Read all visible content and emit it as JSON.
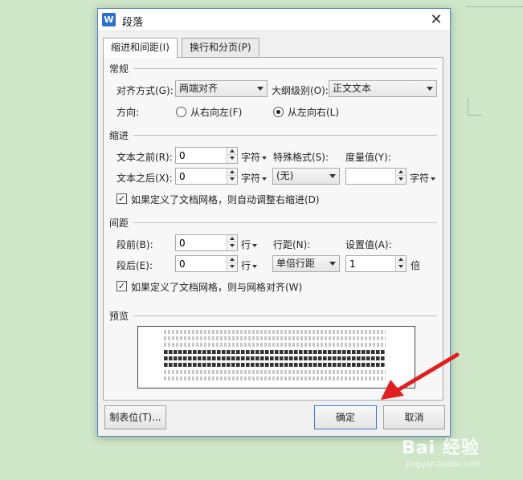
{
  "dialog": {
    "title": "段落",
    "app_icon": "W",
    "close_glyph": "✕"
  },
  "tabs": [
    {
      "label": "缩进和间距(I)",
      "active": true
    },
    {
      "label": "换行和分页(P)",
      "active": false
    }
  ],
  "general": {
    "section_title": "常规",
    "alignment_label": "对齐方式(G):",
    "alignment_value": "两端对齐",
    "outline_label": "大纲级别(O):",
    "outline_value": "正文文本",
    "direction_label": "方向:",
    "rtl_label": "从右向左(F)",
    "ltr_label": "从左向右(L)",
    "ltr_selected": true
  },
  "indent": {
    "section_title": "缩进",
    "before_label": "文本之前(R):",
    "before_value": "0",
    "after_label": "文本之后(X):",
    "after_value": "0",
    "unit": "字符",
    "special_label": "特殊格式(S):",
    "special_value": "(无)",
    "measure_label": "度量值(Y):",
    "measure_value": "",
    "measure_unit": "字符",
    "grid_checkbox_label": "如果定义了文档网格，则自动调整右缩进(D)",
    "grid_checked": true,
    "check_glyph": "✓"
  },
  "spacing": {
    "section_title": "间距",
    "before_label": "段前(B):",
    "before_value": "0",
    "after_label": "段后(E):",
    "after_value": "0",
    "unit": "行",
    "line_spacing_label": "行距(N):",
    "line_spacing_value": "单倍行距",
    "setting_label": "设置值(A):",
    "setting_value": "1",
    "setting_unit": "倍",
    "grid_checkbox_label": "如果定义了文档网格，则与网格对齐(W)",
    "grid_checked": true
  },
  "preview": {
    "section_title": "预览"
  },
  "buttons": {
    "tabs_label": "制表位(T)...",
    "ok_label": "确定",
    "cancel_label": "取消"
  },
  "annotation": {
    "arrow_color": "#e02020"
  },
  "watermark": {
    "text": "Bai 经验",
    "url": "jingyan.baidu.com"
  }
}
